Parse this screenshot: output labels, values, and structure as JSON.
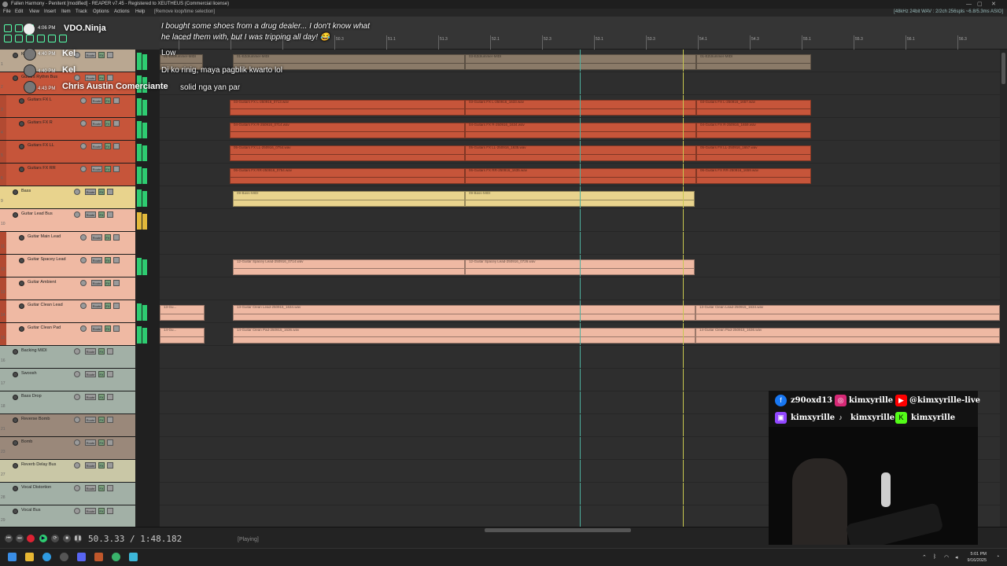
{
  "window": {
    "title": "Fallen Harmony - Penitent [modified] - REAPER v7.45 - Registered to XEUTHEUS (Commercial license)",
    "controls": [
      "—",
      "▢",
      "✕"
    ]
  },
  "menu": {
    "items": [
      "File",
      "Edit",
      "View",
      "Insert",
      "Item",
      "Track",
      "Options",
      "Actions",
      "Help"
    ],
    "hint": "[Remove loop/time selection]",
    "status": "[48kHz 24bit WAV : 2/2ch 256spls ~6.8/5.3ms ASIO]"
  },
  "ruler": {
    "markers": [
      "49.1",
      "49.3",
      "50.1",
      "50.3",
      "51.1",
      "51.3",
      "52.1",
      "52.3",
      "53.1",
      "53.3",
      "54.1",
      "54.3",
      "55.1",
      "55.3",
      "56.1",
      "56.3",
      "57.1"
    ]
  },
  "tracks": [
    {
      "num": "1",
      "name": "Kel",
      "color": "#b9a791"
    },
    {
      "num": "2",
      "name": "Guitars Rythm Bus",
      "color": "#c6553a"
    },
    {
      "num": "3",
      "name": "Guitars FX L",
      "color": "#c6553a"
    },
    {
      "num": "4",
      "name": "Guitars FX R",
      "color": "#c6553a"
    },
    {
      "num": "5",
      "name": "Guitars FX LL",
      "color": "#c6553a"
    },
    {
      "num": "6",
      "name": "Guitars FX RR",
      "color": "#c6553a"
    },
    {
      "num": "9",
      "name": "Bass",
      "color": "#e8d38d"
    },
    {
      "num": "10",
      "name": "Guitar Lead Bus",
      "color": "#efb9a3"
    },
    {
      "num": "11",
      "name": "Guitar Main Lead",
      "color": "#efb9a3"
    },
    {
      "num": "12",
      "name": "Guitar Spacey Lead",
      "color": "#efb9a3"
    },
    {
      "num": "13",
      "name": "Guitar Ambient",
      "color": "#efb9a3"
    },
    {
      "num": "14",
      "name": "Guitar Clean Lead",
      "color": "#efb9a3"
    },
    {
      "num": "15",
      "name": "Guitar Clean Pad",
      "color": "#efb9a3"
    },
    {
      "num": "16",
      "name": "Backing MIDI",
      "color": "#a2b0a6"
    },
    {
      "num": "17",
      "name": "Swoosh",
      "color": "#a2b0a6"
    },
    {
      "num": "18",
      "name": "Bass Drop",
      "color": "#a2b0a6"
    },
    {
      "num": "21",
      "name": "Reverse Bomb",
      "color": "#9a887a"
    },
    {
      "num": "23",
      "name": "Bomb",
      "color": "#9a887a"
    },
    {
      "num": "27",
      "name": "Reverb Delay Bus",
      "color": "#c9c7a6"
    },
    {
      "num": "28",
      "name": "Vocal Distortion",
      "color": "#a2b0a6"
    },
    {
      "num": "29",
      "name": "Vocal Bus",
      "color": "#a2b0a6"
    }
  ],
  "track_buttons": {
    "route": "Route",
    "fx": "FX"
  },
  "items": {
    "drummer1": "01-EZdrummer-MIDI",
    "drummer2": "01-EZdrummer-MIDI",
    "drummer3": "03-EZdrummer-MIDI",
    "drummer4": "01-EZdrummer-MIDI",
    "fxl_a": "03-Guitars FX L-250916_0713.wav",
    "fxl_b": "03-Guitars FX L-250916_1633.wav",
    "fxl_c": "03-Guitars FX L-250916_1657.wav",
    "fxr_a": "04-Guitars FX R-250916_0714.wav",
    "fxr_b": "04-Guitars FX R-250916_1634.wav",
    "fxr_c": "04-Guitars FX R-250916_1659.wav",
    "fxll_a": "05-Guitars FX LL-250916_0754.wav",
    "fxll_b": "05-Guitars FX LL-250916_1635.wav",
    "fxll_c": "05-Guitars FX LL-250916_1657.wav",
    "fxrr_a": "06-Guitars FX RR-250916_0754.wav",
    "fxrr_b": "06-Guitars FX RR-250916_1635.wav",
    "fxrr_c": "06-Guitars FX RR-250916_1659.wav",
    "bass_a": "09-Bass-MIDI",
    "bass_b": "09-Bass-MIDI",
    "spacey_a": "12-Guitar Spacey Lead-250916_0714.wav",
    "spacey_b": "12-Guitar Spacey Lead-250916_0726.wav",
    "clean_lead_pre": "13-Gu...",
    "clean_lead_a": "13-Guitar Clean Lead-250915_1634.wav",
    "clean_lead_b": "13-Guitar Clean Lead-250915_1634.wav",
    "clean_pad_pre": "14-Gu...",
    "clean_pad_a": "14-Guitar Clean Pad-250915_1636.wav",
    "clean_pad_b": "14-Guitar Clean Pad-250915_1636.wav"
  },
  "transport": {
    "time": "50.3.33 / 1:48.182",
    "state": "[Playing]"
  },
  "taskbar": {
    "time": "5:01 PM",
    "date": "9/16/2025"
  },
  "overlay": {
    "brand": "VDO.Ninja",
    "brand_time": "4:06 PM",
    "top_message_1": "I bought some shoes from a drug dealer... I don't know what",
    "top_message_2": "he laced them with, but I was tripping all day! 😂",
    "chats": [
      {
        "time": "4:40 PM",
        "user": "Kel",
        "message": "Low"
      },
      {
        "time": "4:40 PM",
        "user": "Kel",
        "message": "Di ko rinig, maya pagblik kwarto lol"
      },
      {
        "time": "4:43 PM",
        "user": "Chris Austin Comerciante",
        "message": "solid nga yan par"
      }
    ]
  },
  "socials": {
    "facebook": "z90oxd13",
    "instagram": "kimxyrille",
    "youtube": "@kimxyrille-live",
    "twitch": "kimxyrille",
    "tiktok": "kimxyrille",
    "kick": "kimxyrille"
  }
}
